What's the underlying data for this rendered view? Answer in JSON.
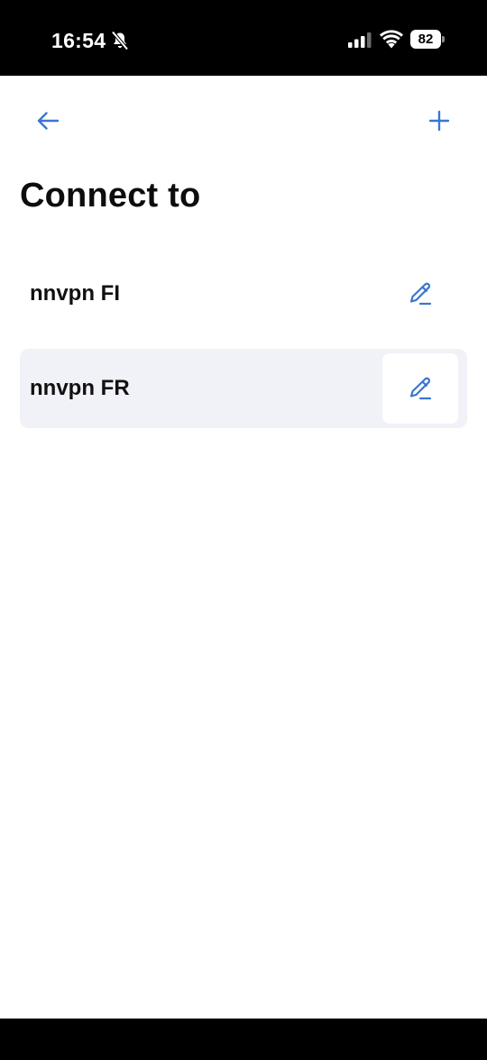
{
  "status_bar": {
    "time": "16:54",
    "battery": "82"
  },
  "header": {
    "title": "Connect to"
  },
  "servers": [
    {
      "name": "nnvpn FI",
      "selected": false
    },
    {
      "name": "nnvpn FR",
      "selected": true
    }
  ],
  "colors": {
    "accent": "#3a76d0",
    "selected_row": "#f1f1f8"
  }
}
